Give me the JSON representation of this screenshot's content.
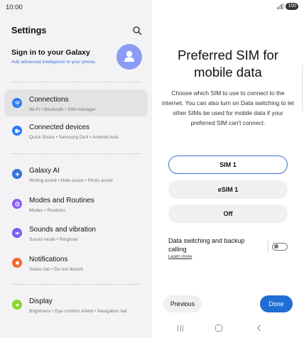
{
  "status": {
    "time": "10:00",
    "battery": "100"
  },
  "settings": {
    "title": "Settings",
    "signin": {
      "title": "Sign in to your Galaxy",
      "subtitle": "Add advanced intelligence to your phone."
    },
    "items": [
      {
        "title": "Connections",
        "subtitle": "Wi-Fi  •  Bluetooth  •  SIM manager",
        "icon": "wifi-icon",
        "color": "#2f7bf0"
      },
      {
        "title": "Connected devices",
        "subtitle": "Quick Share  •  Samsung DeX  •  Android Auto",
        "icon": "devices-icon",
        "color": "#2f7bf0"
      },
      {
        "title": "Galaxy AI",
        "subtitle": "Writing assist  •  Note assist  •  Photo assist",
        "icon": "galaxy-ai-icon",
        "color": "#3a6fd8"
      },
      {
        "title": "Modes and Routines",
        "subtitle": "Modes  •  Routines",
        "icon": "modes-icon",
        "color": "#8a5cf0"
      },
      {
        "title": "Sounds and vibration",
        "subtitle": "Sound mode  •  Ringtone",
        "icon": "sound-icon",
        "color": "#7b5cf0"
      },
      {
        "title": "Notifications",
        "subtitle": "Status bar  •  Do not disturb",
        "icon": "notifications-icon",
        "color": "#f06a2f"
      },
      {
        "title": "Display",
        "subtitle": "Brightness  •  Eye comfort shield  •  Navigation bar",
        "icon": "display-icon",
        "color": "#8bd12f"
      }
    ]
  },
  "preferred_sim": {
    "title": "Preferred SIM for mobile data",
    "description": "Choose which SIM to use to connect to the internet. You can also turn on Data switching to let other SIMs be used for mobile data if your preferred SIM can't connect.",
    "options": [
      "SIM 1",
      "eSIM 1",
      "Off"
    ],
    "selected": "SIM 1",
    "data_switching_label": "Data switching and backup calling",
    "learn_more": "Learn more",
    "data_switching_on": false,
    "previous_label": "Previous",
    "done_label": "Done"
  },
  "colors": {
    "accent": "#1f6ed4",
    "selected_border": "#3a6fd8",
    "avatar": "#8a9cf6"
  }
}
